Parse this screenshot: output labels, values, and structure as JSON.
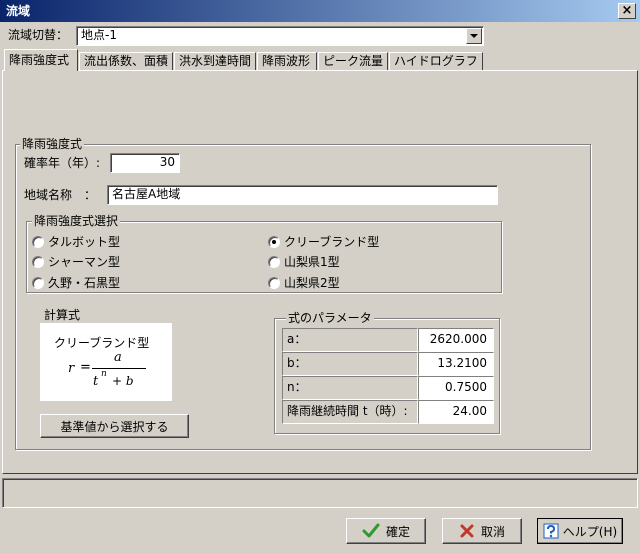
{
  "window": {
    "title": "流域",
    "close_glyph": "×"
  },
  "basin_switch": {
    "label": "流域切替：",
    "value": "地点-1"
  },
  "tabs": [
    {
      "label": "降雨強度式",
      "active": true
    },
    {
      "label": "流出係数、面積",
      "active": false
    },
    {
      "label": "洪水到達時間",
      "active": false
    },
    {
      "label": "降雨波形",
      "active": false
    },
    {
      "label": "ピーク流量",
      "active": false
    },
    {
      "label": "ハイドログラフ",
      "active": false
    }
  ],
  "intensity": {
    "group_title": "降雨強度式",
    "return_period": {
      "label": "確率年（年）:",
      "value": "30"
    },
    "region": {
      "label": "地域名称　：",
      "value": "名古屋A地域"
    },
    "selection": {
      "title": "降雨強度式選択",
      "options": [
        {
          "label": "タルボット型",
          "selected": false
        },
        {
          "label": "クリーブランド型",
          "selected": true
        },
        {
          "label": "シャーマン型",
          "selected": false
        },
        {
          "label": "山梨県1型",
          "selected": false
        },
        {
          "label": "久野・石黒型",
          "selected": false
        },
        {
          "label": "山梨県2型",
          "selected": false
        }
      ]
    },
    "formula": {
      "title": "計算式",
      "name": "クリーブランド型",
      "lhs": "r",
      "eq": "=",
      "numerator": "a",
      "den_base": "t",
      "den_exp": "n",
      "den_rest": "+ b"
    },
    "select_button": "基準値から選択する",
    "params": {
      "title": "式のパラメータ",
      "rows": [
        {
          "label": "a：",
          "value": "2620.000"
        },
        {
          "label": "b：",
          "value": "13.2100"
        },
        {
          "label": "n：",
          "value": "0.7500"
        },
        {
          "label": "降雨継続時間 t（時）:",
          "value": "24.00"
        }
      ]
    }
  },
  "footer": {
    "ok": "確定",
    "cancel": "取消",
    "help": "ヘルプ(H)"
  },
  "colors": {
    "face": "#d4d0c8",
    "title_start": "#0a246a",
    "title_end": "#a6caf0",
    "ok_check": "#2e9a2e",
    "cancel_x": "#c0392b",
    "help_blue": "#1f5fbf"
  }
}
